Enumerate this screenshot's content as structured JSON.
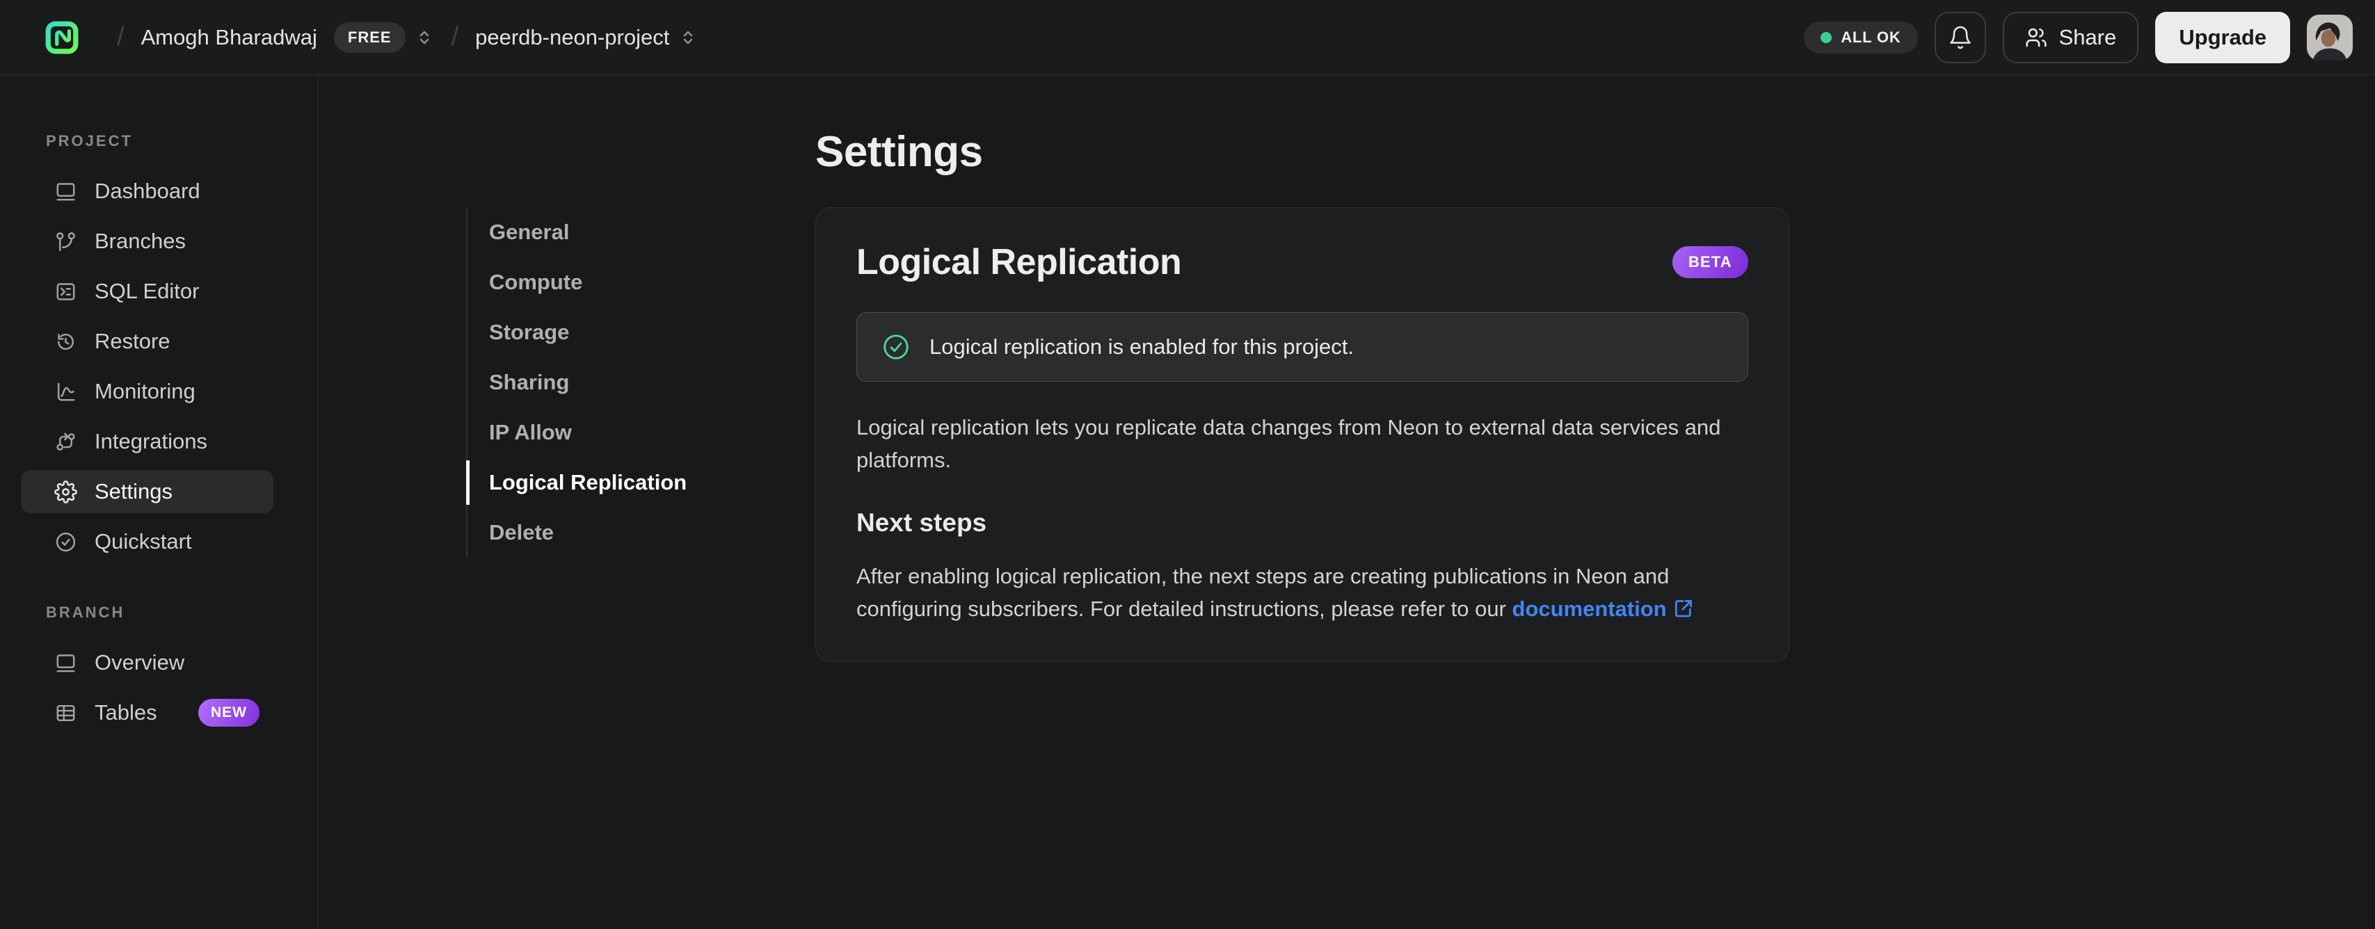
{
  "topbar": {
    "breadcrumb_separator": "/",
    "org_name": "Amogh Bharadwaj",
    "plan_badge": "FREE",
    "project_name": "peerdb-neon-project",
    "status_label": "ALL OK",
    "share_label": "Share",
    "upgrade_label": "Upgrade"
  },
  "sidebar": {
    "sections": [
      {
        "label": "PROJECT",
        "items": [
          {
            "label": "Dashboard"
          },
          {
            "label": "Branches"
          },
          {
            "label": "SQL Editor"
          },
          {
            "label": "Restore"
          },
          {
            "label": "Monitoring"
          },
          {
            "label": "Integrations"
          },
          {
            "label": "Settings",
            "active": true
          },
          {
            "label": "Quickstart"
          }
        ]
      },
      {
        "label": "BRANCH",
        "items": [
          {
            "label": "Overview"
          },
          {
            "label": "Tables",
            "badge": "NEW"
          }
        ]
      }
    ]
  },
  "main": {
    "page_title": "Settings",
    "settings_nav": [
      {
        "label": "General"
      },
      {
        "label": "Compute"
      },
      {
        "label": "Storage"
      },
      {
        "label": "Sharing"
      },
      {
        "label": "IP Allow"
      },
      {
        "label": "Logical Replication",
        "active": true
      },
      {
        "label": "Delete"
      }
    ],
    "card": {
      "title": "Logical Replication",
      "beta_badge": "BETA",
      "banner_text": "Logical replication is enabled for this project.",
      "description": "Logical replication lets you replicate data changes from Neon to external data services and platforms.",
      "next_steps_title": "Next steps",
      "next_steps_text": "After enabling logical replication, the next steps are creating publications in Neon and configuring subscribers. For detailed instructions, please refer to our ",
      "doc_link_label": "documentation"
    }
  },
  "colors": {
    "accent_green": "#3ecf8e",
    "success_icon_green": "#4cd996",
    "link_blue": "#4285f4",
    "badge_purple_start": "#a763f2",
    "badge_purple_end": "#7c2bd9",
    "background": "#181919",
    "card_background": "#1d1e1f"
  }
}
